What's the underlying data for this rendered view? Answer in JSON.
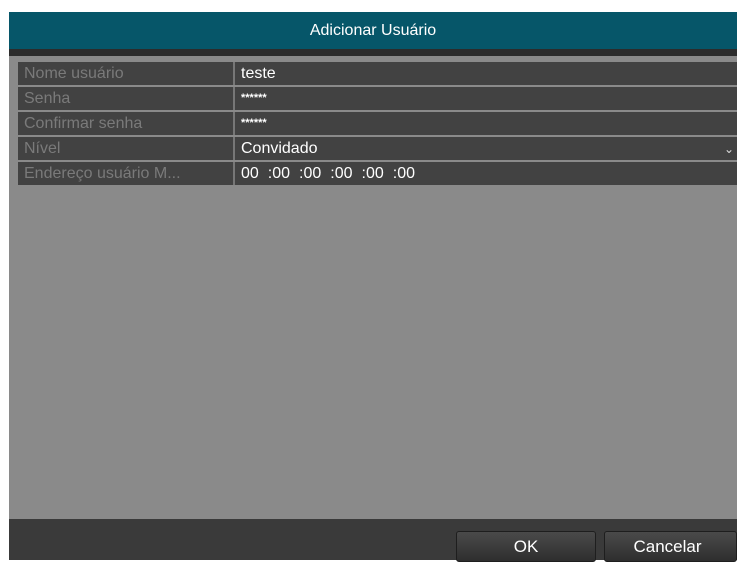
{
  "dialog": {
    "title": "Adicionar Usuário",
    "fields": [
      {
        "label": "Nome usuário",
        "value": "teste"
      },
      {
        "label": "Senha",
        "value": "******"
      },
      {
        "label": "Confirmar senha",
        "value": "******"
      },
      {
        "label": "Nível",
        "value": "Convidado"
      },
      {
        "label": "Endereço usuário M...",
        "mac": [
          "00",
          ":00",
          ":00",
          ":00",
          ":00",
          ":00"
        ]
      }
    ],
    "dropdown_icon": "chevron-down-icon",
    "ok_label": "OK",
    "cancel_label": "Cancelar"
  },
  "colors": {
    "titlebar": "#065669",
    "field_bg": "#424242",
    "dialog_bg": "#8a8a8a",
    "footer_bg": "#3a3a3a"
  }
}
